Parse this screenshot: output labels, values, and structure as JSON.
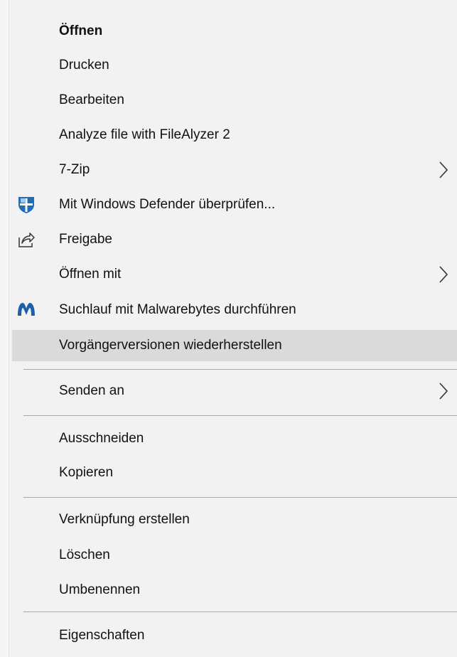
{
  "context_menu": {
    "items": {
      "open": "Öffnen",
      "print": "Drucken",
      "edit": "Bearbeiten",
      "filealyzer": "Analyze file with FileAlyzer 2",
      "zip": "7-Zip",
      "defender": "Mit Windows Defender überprüfen...",
      "share": "Freigabe",
      "open_with": "Öffnen mit",
      "malwarebytes": "Suchlauf mit Malwarebytes durchführen",
      "restore_versions": "Vorgängerversionen wiederherstellen",
      "send_to": "Senden an",
      "cut": "Ausschneiden",
      "copy": "Kopieren",
      "create_shortcut": "Verknüpfung erstellen",
      "delete": "Löschen",
      "rename": "Umbenennen",
      "properties": "Eigenschaften"
    },
    "icons": {
      "defender": "windows-defender-shield-icon",
      "share": "share-icon",
      "malwarebytes": "malwarebytes-logo-icon",
      "submenu": "chevron-right-icon"
    },
    "hovered_item": "Vorgängerversionen wiederherstellen",
    "colors": {
      "background": "#f2f2f2",
      "hover": "#dadada",
      "separator": "#a8a8a8",
      "defender_blue": "#1f6fb8",
      "malwarebytes_blue": "#1d5fa8"
    }
  }
}
